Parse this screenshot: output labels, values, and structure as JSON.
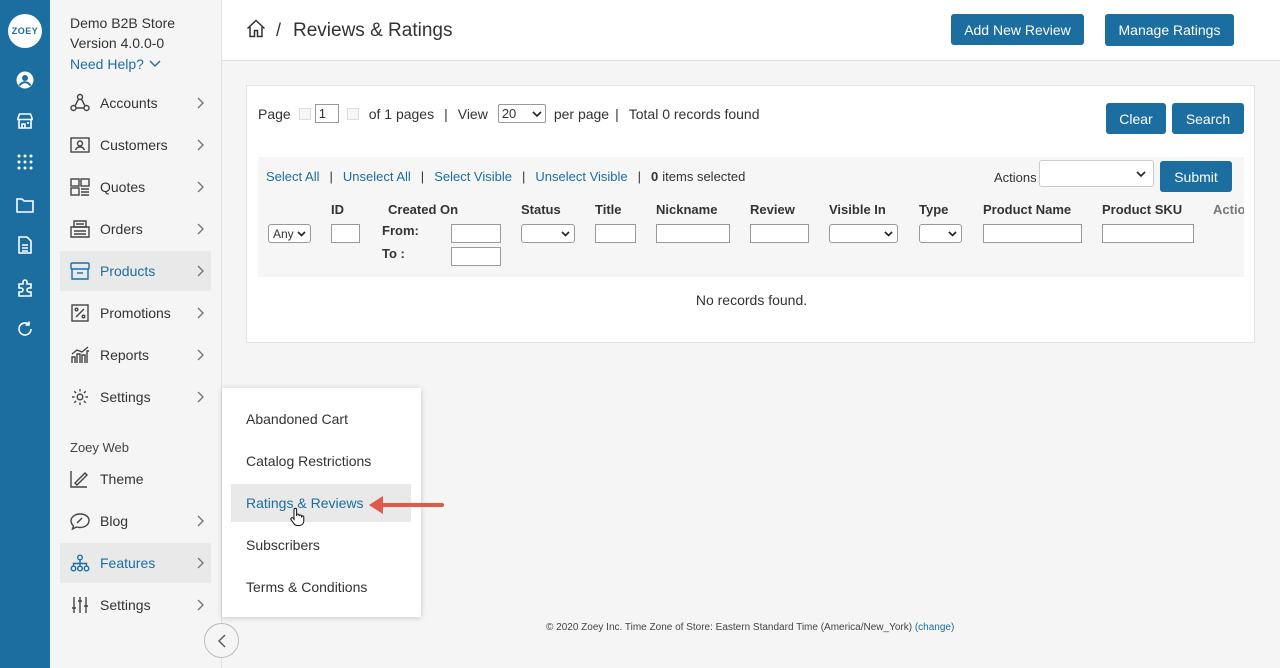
{
  "rail": {
    "logo_text": "ZOEY",
    "icons": [
      "account-circle-icon",
      "storefront-icon",
      "apps-grid-icon",
      "folder-icon",
      "document-icon",
      "puzzle-icon",
      "refresh-icon"
    ]
  },
  "sidebar": {
    "store_name": "Demo B2B Store",
    "version": "Version 4.0.0-0",
    "need_help": "Need Help?",
    "items": [
      {
        "label": "Accounts"
      },
      {
        "label": "Customers"
      },
      {
        "label": "Quotes"
      },
      {
        "label": "Orders"
      },
      {
        "label": "Products"
      },
      {
        "label": "Promotions"
      },
      {
        "label": "Reports"
      },
      {
        "label": "Settings"
      }
    ],
    "web_section": "Zoey Web",
    "web_items": [
      {
        "label": "Theme"
      },
      {
        "label": "Blog"
      },
      {
        "label": "Features"
      },
      {
        "label": "Settings"
      }
    ]
  },
  "header": {
    "separator": "/",
    "title": "Reviews & Ratings",
    "add_button": "Add New Review",
    "manage_button": "Manage Ratings"
  },
  "grid": {
    "page_label": "Page",
    "page_value": "1",
    "of_pages": "of 1 pages",
    "view_label": "View",
    "per_page_value": "20",
    "per_page_label": "per page",
    "total": "Total 0 records found",
    "clear_button": "Clear",
    "search_button": "Search",
    "select_all": "Select All",
    "unselect_all": "Unselect All",
    "select_visible": "Select Visible",
    "unselect_visible": "Unselect Visible",
    "selected_count": "0",
    "selected_suffix": "items selected",
    "actions_label": "Actions",
    "submit_button": "Submit",
    "any_value": "Any",
    "columns": {
      "id": "ID",
      "created_on": "Created On",
      "status": "Status",
      "title": "Title",
      "nickname": "Nickname",
      "review": "Review",
      "visible_in": "Visible In",
      "type": "Type",
      "product_name": "Product Name",
      "product_sku": "Product SKU",
      "action": "Actio"
    },
    "from_label": "From:",
    "to_label": "To :",
    "empty": "No records found."
  },
  "flyout": {
    "items": [
      {
        "label": "Abandoned Cart"
      },
      {
        "label": "Catalog Restrictions"
      },
      {
        "label": "Ratings & Reviews"
      },
      {
        "label": "Subscribers"
      },
      {
        "label": "Terms & Conditions"
      }
    ],
    "highlight_color": "#e74c3c"
  },
  "footer": {
    "text": "© 2020 Zoey Inc. Time Zone of Store: Eastern Standard Time (America/New_York)",
    "change": "(change)"
  },
  "colors": {
    "brand": "#1b6e9f",
    "arrow": "#e05a4a"
  }
}
